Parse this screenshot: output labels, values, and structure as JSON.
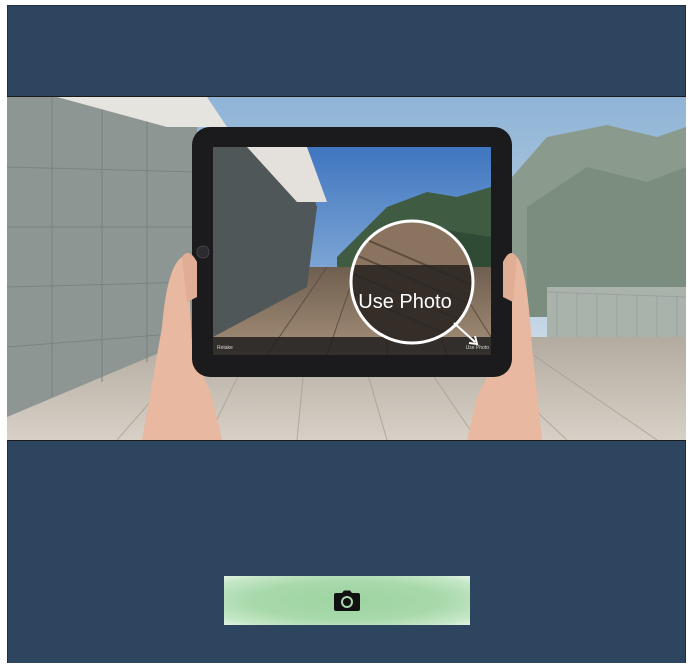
{
  "photo": {
    "magnified_label": "Use Photo",
    "screen_left_label": "Retake",
    "screen_right_label": "Use Photo"
  },
  "action": {
    "icon": "camera-icon"
  },
  "colors": {
    "background": "#2e4560",
    "button": "#a8d9ab",
    "icon": "#111111"
  }
}
